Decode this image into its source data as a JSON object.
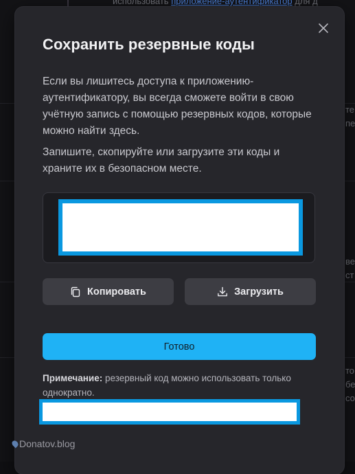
{
  "background": {
    "top_text_prefix": "использовать ",
    "top_link": "приложение-аутентификатор",
    "top_text_suffix": " для д",
    "right_fragments": [
      "те",
      "пе",
      "ве",
      "ст",
      "то",
      "бе",
      "со"
    ]
  },
  "dialog": {
    "title": "Сохранить резервные коды",
    "close_icon": "close-icon",
    "paragraph1": "Если вы лишитесь доступа к приложению-аутентификатору, вы всегда сможете войти в свою учётную запись с помощью резервных кодов, которые можно найти здесь.",
    "paragraph2": "Запишите, скопируйте или загрузите эти коды и храните их в безопасном месте.",
    "copy_button": {
      "label": "Копировать",
      "icon": "copy-icon"
    },
    "download_button": {
      "label": "Загрузить",
      "icon": "download-icon"
    },
    "done_button": {
      "label": "Готово"
    },
    "note_label": "Примечание:",
    "note_text": " резервный код можно использовать только однократно."
  },
  "watermark": {
    "text": "Donatov.blog"
  },
  "colors": {
    "dialog_bg": "#26262b",
    "primary": "#1fb2f5",
    "secondary_button": "#3d3d43",
    "redaction_border": "#0a98e0"
  }
}
